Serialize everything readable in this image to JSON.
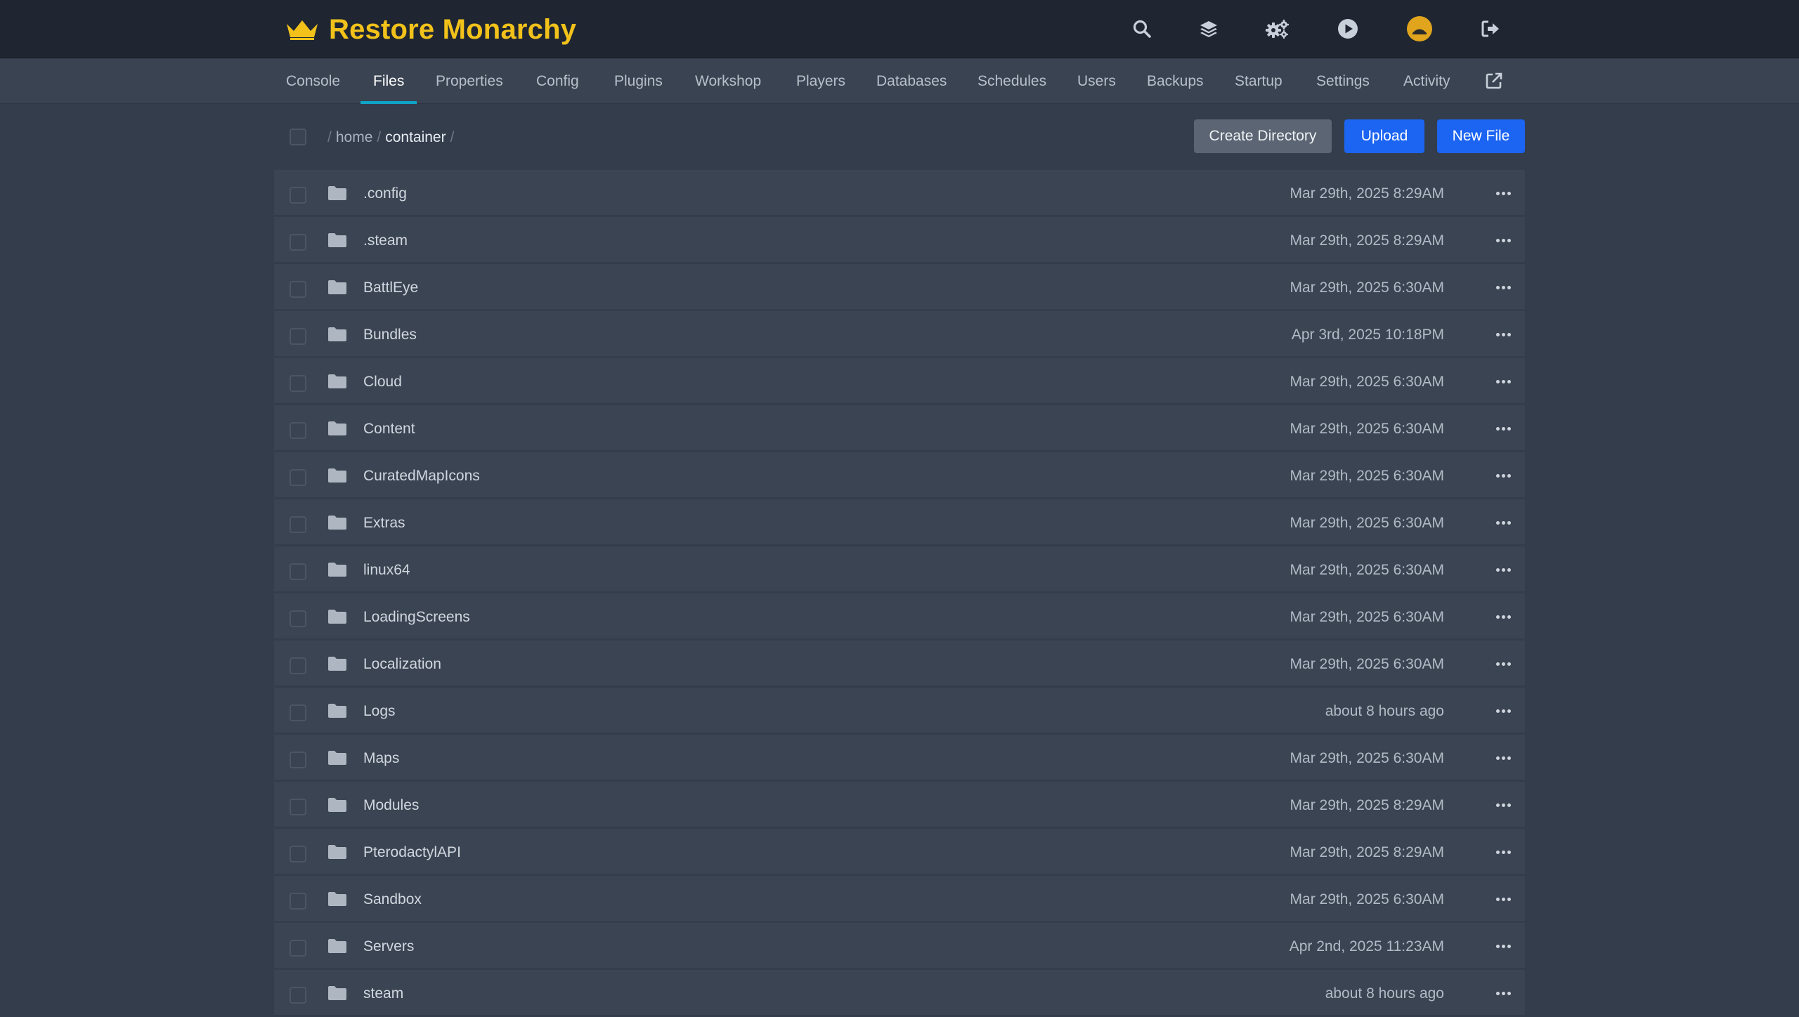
{
  "header": {
    "title": "Restore Monarchy",
    "brand_color": "#f2c21a",
    "icons": [
      "crown-icon",
      "search-icon",
      "layers-icon",
      "cogs-icon",
      "play-icon",
      "avatar",
      "logout-icon"
    ]
  },
  "nav": {
    "items": [
      {
        "label": "Console"
      },
      {
        "label": "Files",
        "active": true
      },
      {
        "label": "Properties"
      },
      {
        "label": "Config"
      },
      {
        "label": "Plugins"
      },
      {
        "label": "Workshop"
      },
      {
        "label": "Players"
      },
      {
        "label": "Databases"
      },
      {
        "label": "Schedules"
      },
      {
        "label": "Users"
      },
      {
        "label": "Backups"
      },
      {
        "label": "Startup"
      },
      {
        "label": "Settings"
      },
      {
        "label": "Activity"
      }
    ],
    "external_icon": "external-link-icon",
    "accent_color": "#0ea5c6"
  },
  "toolbar": {
    "breadcrumb": {
      "parts": [
        "home",
        "container"
      ],
      "separator": "/"
    },
    "create_directory_label": "Create Directory",
    "upload_label": "Upload",
    "new_file_label": "New File",
    "button_color": "#1c64f2"
  },
  "files": [
    {
      "name": ".config",
      "modified": "Mar 29th, 2025 8:29AM"
    },
    {
      "name": ".steam",
      "modified": "Mar 29th, 2025 8:29AM"
    },
    {
      "name": "BattlEye",
      "modified": "Mar 29th, 2025 6:30AM"
    },
    {
      "name": "Bundles",
      "modified": "Apr 3rd, 2025 10:18PM"
    },
    {
      "name": "Cloud",
      "modified": "Mar 29th, 2025 6:30AM"
    },
    {
      "name": "Content",
      "modified": "Mar 29th, 2025 6:30AM"
    },
    {
      "name": "CuratedMapIcons",
      "modified": "Mar 29th, 2025 6:30AM"
    },
    {
      "name": "Extras",
      "modified": "Mar 29th, 2025 6:30AM"
    },
    {
      "name": "linux64",
      "modified": "Mar 29th, 2025 6:30AM"
    },
    {
      "name": "LoadingScreens",
      "modified": "Mar 29th, 2025 6:30AM"
    },
    {
      "name": "Localization",
      "modified": "Mar 29th, 2025 6:30AM"
    },
    {
      "name": "Logs",
      "modified": "about 8 hours ago"
    },
    {
      "name": "Maps",
      "modified": "Mar 29th, 2025 6:30AM"
    },
    {
      "name": "Modules",
      "modified": "Mar 29th, 2025 8:29AM"
    },
    {
      "name": "PterodactylAPI",
      "modified": "Mar 29th, 2025 8:29AM"
    },
    {
      "name": "Sandbox",
      "modified": "Mar 29th, 2025 6:30AM"
    },
    {
      "name": "Servers",
      "modified": "Apr 2nd, 2025 11:23AM"
    },
    {
      "name": "steam",
      "modified": "about 8 hours ago"
    }
  ]
}
